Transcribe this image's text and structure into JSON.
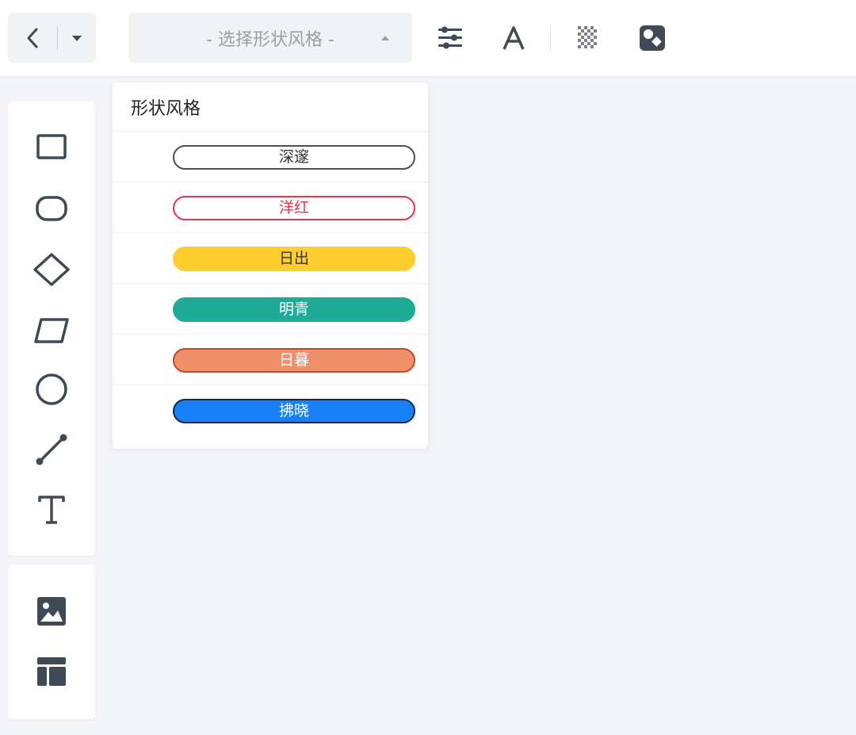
{
  "toolbar": {
    "style_select": {
      "placeholder": "- 选择形状风格 -"
    },
    "icons": {
      "back": "chevron-left-icon",
      "dropdown": "caret-down-icon",
      "caret_up": "caret-up-icon",
      "settings": "sliders-icon",
      "font": "font-icon",
      "transparency": "checkerboard-icon",
      "style": "palette-icon"
    }
  },
  "tools": {
    "shapes": [
      {
        "name": "rectangle",
        "icon": "rectangle-icon"
      },
      {
        "name": "rounded-rectangle",
        "icon": "rounded-rect-icon"
      },
      {
        "name": "diamond",
        "icon": "diamond-icon"
      },
      {
        "name": "parallelogram",
        "icon": "parallelogram-icon"
      },
      {
        "name": "circle",
        "icon": "circle-icon"
      },
      {
        "name": "line",
        "icon": "line-icon"
      },
      {
        "name": "text",
        "icon": "text-icon"
      }
    ],
    "media": [
      {
        "name": "image",
        "icon": "image-icon"
      },
      {
        "name": "layout",
        "icon": "layout-icon"
      }
    ]
  },
  "dropdown": {
    "title": "形状风格",
    "options": [
      {
        "label": "深邃",
        "bg": "#ffffff",
        "border": "#495057",
        "text": "#333333"
      },
      {
        "label": "洋红",
        "bg": "#ffffff",
        "border": "#e8334a",
        "text": "#e8334a"
      },
      {
        "label": "日出",
        "bg": "#ffcd2e",
        "border": "#ffcd2e",
        "text": "#333333"
      },
      {
        "label": "明青",
        "bg": "#1eac99",
        "border": "#1eac99",
        "text": "#ffffff"
      },
      {
        "label": "日暮",
        "bg": "#ef906b",
        "border": "#c34a20",
        "text": "#ffffff"
      },
      {
        "label": "拂晓",
        "bg": "#1a80f7",
        "border": "#0a2a60",
        "text": "#ffffff"
      }
    ]
  },
  "colors": {
    "icon": "#3f4a55",
    "background": "#f4f5f9"
  }
}
